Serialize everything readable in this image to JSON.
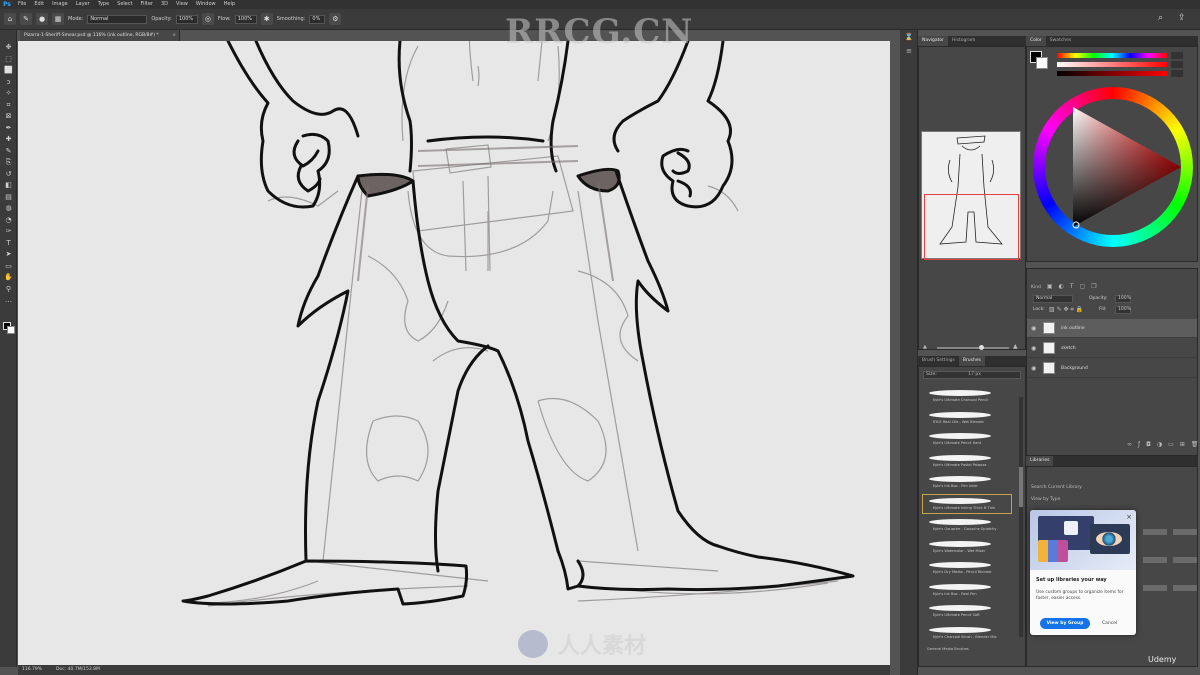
{
  "app": {
    "logo": "Ps",
    "menus": [
      "File",
      "Edit",
      "Image",
      "Layer",
      "Type",
      "Select",
      "Filter",
      "3D",
      "View",
      "Window",
      "Help"
    ]
  },
  "options_bar": {
    "mode_label": "Mode:",
    "mode_value": "Normal",
    "opacity_label": "Opacity:",
    "opacity_value": "100%",
    "flow_label": "Flow:",
    "flow_value": "100%",
    "smoothing_label": "Smoothing:",
    "smoothing_value": "0%"
  },
  "document_tab": {
    "title": "Pizarra-1-Sheriff-Smear.psd @ 116% (ink outline, RGB/8#) *"
  },
  "status": {
    "zoom": "116.79%",
    "doc": "Doc: 40.7M/153.8M"
  },
  "navigator": {
    "tabs": [
      "Navigator",
      "Histogram"
    ],
    "zoom": "116.79%"
  },
  "brushes": {
    "tabs": [
      "Brush Settings",
      "Brushes"
    ],
    "size_label": "Size:",
    "size_value": "17 px",
    "items": [
      "Kyle's Ultimate Charcoal Pencil",
      "KYLE Real Oils - Wet Blender",
      "Kyle's Ultimate Pencil Hard",
      "Kyle's Ultimate Pastel Palooza",
      "Kyle's Ink Box - Pen Inker",
      "Kyle's Ultimate Inking Thick N Thin",
      "Kyle's Gouache - Gouache Splotchy",
      "Kyle's Watercolor - Wet Mixer",
      "Kyle's Dry Media - Pencil Blender",
      "Kyle's Ink Box - Real Pen",
      "Kyle's Ultimate Pencil Soft",
      "Kyle's Charcoal Brush - Blender Mix"
    ],
    "selected_index": 5,
    "folder": "General Media Brushes"
  },
  "color": {
    "tabs": [
      "Color",
      "Swatches"
    ],
    "fg": "#000000",
    "bg": "#ffffff"
  },
  "layers": {
    "tabs": [
      "Layers",
      "Channels",
      "Paths"
    ],
    "kind_label": "Kind",
    "blend_mode": "Normal",
    "opacity_label": "Opacity:",
    "opacity_value": "100%",
    "lock_label": "Lock:",
    "fill_label": "Fill:",
    "fill_value": "100%",
    "rows": [
      {
        "name": "ink outline",
        "active": true
      },
      {
        "name": "sketch",
        "active": false
      },
      {
        "name": "Background",
        "active": false
      }
    ]
  },
  "libraries": {
    "tabs": [
      "Libraries"
    ],
    "search_placeholder": "Search Current Library",
    "view_label": "View by Type"
  },
  "popup": {
    "title": "Set up libraries your way",
    "body": "Use custom groups to organize items for faster, easier access.",
    "primary": "View by Group",
    "cancel": "Cancel"
  },
  "watermarks": {
    "top": "RRCG.CN",
    "bottom": "人人素材"
  },
  "brand": {
    "udemy": "Udemy"
  },
  "colors": {
    "accent": "#1473e6",
    "ui_dark": "#3b3b3b",
    "selection": "#e64040"
  }
}
